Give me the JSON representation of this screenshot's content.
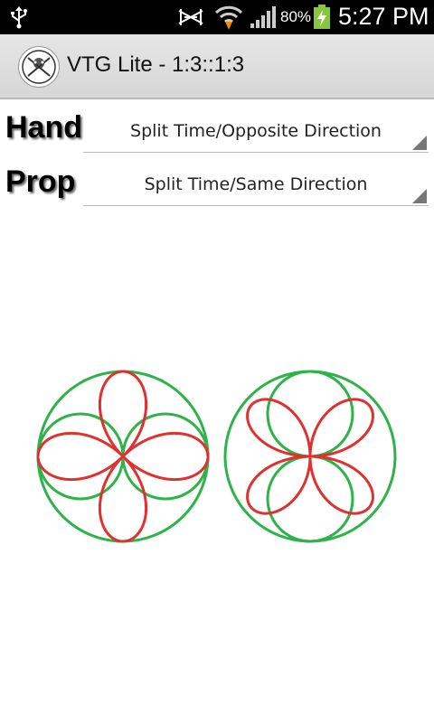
{
  "status_bar": {
    "battery_percent": "80%",
    "time": "5:27 PM",
    "icons": [
      "usb-icon",
      "no-signal-icon",
      "wifi-icon",
      "cell-signal-icon",
      "battery-charging-icon"
    ]
  },
  "app_bar": {
    "title": "VTG Lite - 1:3::1:3",
    "logo_icon": "app-logo-icon"
  },
  "controls": {
    "hand": {
      "label": "Hand",
      "selected": "Split Time/Opposite Direction"
    },
    "prop": {
      "label": "Prop",
      "selected": "Split Time/Same Direction"
    }
  },
  "colors": {
    "hand_path": "#2db34a",
    "prop_path": "#e03030",
    "status_bar_bg": "#000000",
    "app_bar_bg": "#dcdcdc"
  }
}
